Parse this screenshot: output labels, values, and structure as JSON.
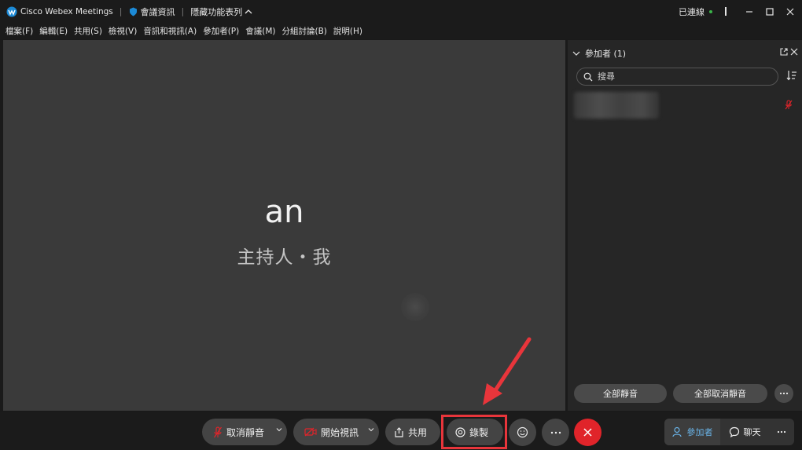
{
  "titlebar": {
    "app_name": "Cisco Webex Meetings",
    "meeting_info": "會議資訊",
    "hidden_menu": "隱藏功能表列",
    "status": "已連線"
  },
  "menubar": {
    "items": [
      "檔案(F)",
      "編輯(E)",
      "共用(S)",
      "檢視(V)",
      "音訊和視訊(A)",
      "參加者(P)",
      "會議(M)",
      "分組討論(B)",
      "說明(H)"
    ]
  },
  "stage": {
    "name": "an",
    "role": "主持人・我"
  },
  "panel": {
    "title": "參加者 (1)",
    "search_placeholder": "搜尋",
    "mute_all": "全部靜音",
    "unmute_all": "全部取消靜音"
  },
  "toolbar": {
    "unmute": "取消靜音",
    "start_video": "開始視訊",
    "share": "共用",
    "record": "錄製",
    "participants": "參加者",
    "chat": "聊天"
  },
  "colors": {
    "accent_blue": "#6ab4e8",
    "end_red": "#e0242a",
    "highlight_red": "#e8353b",
    "connected_green": "#3bb54a"
  }
}
